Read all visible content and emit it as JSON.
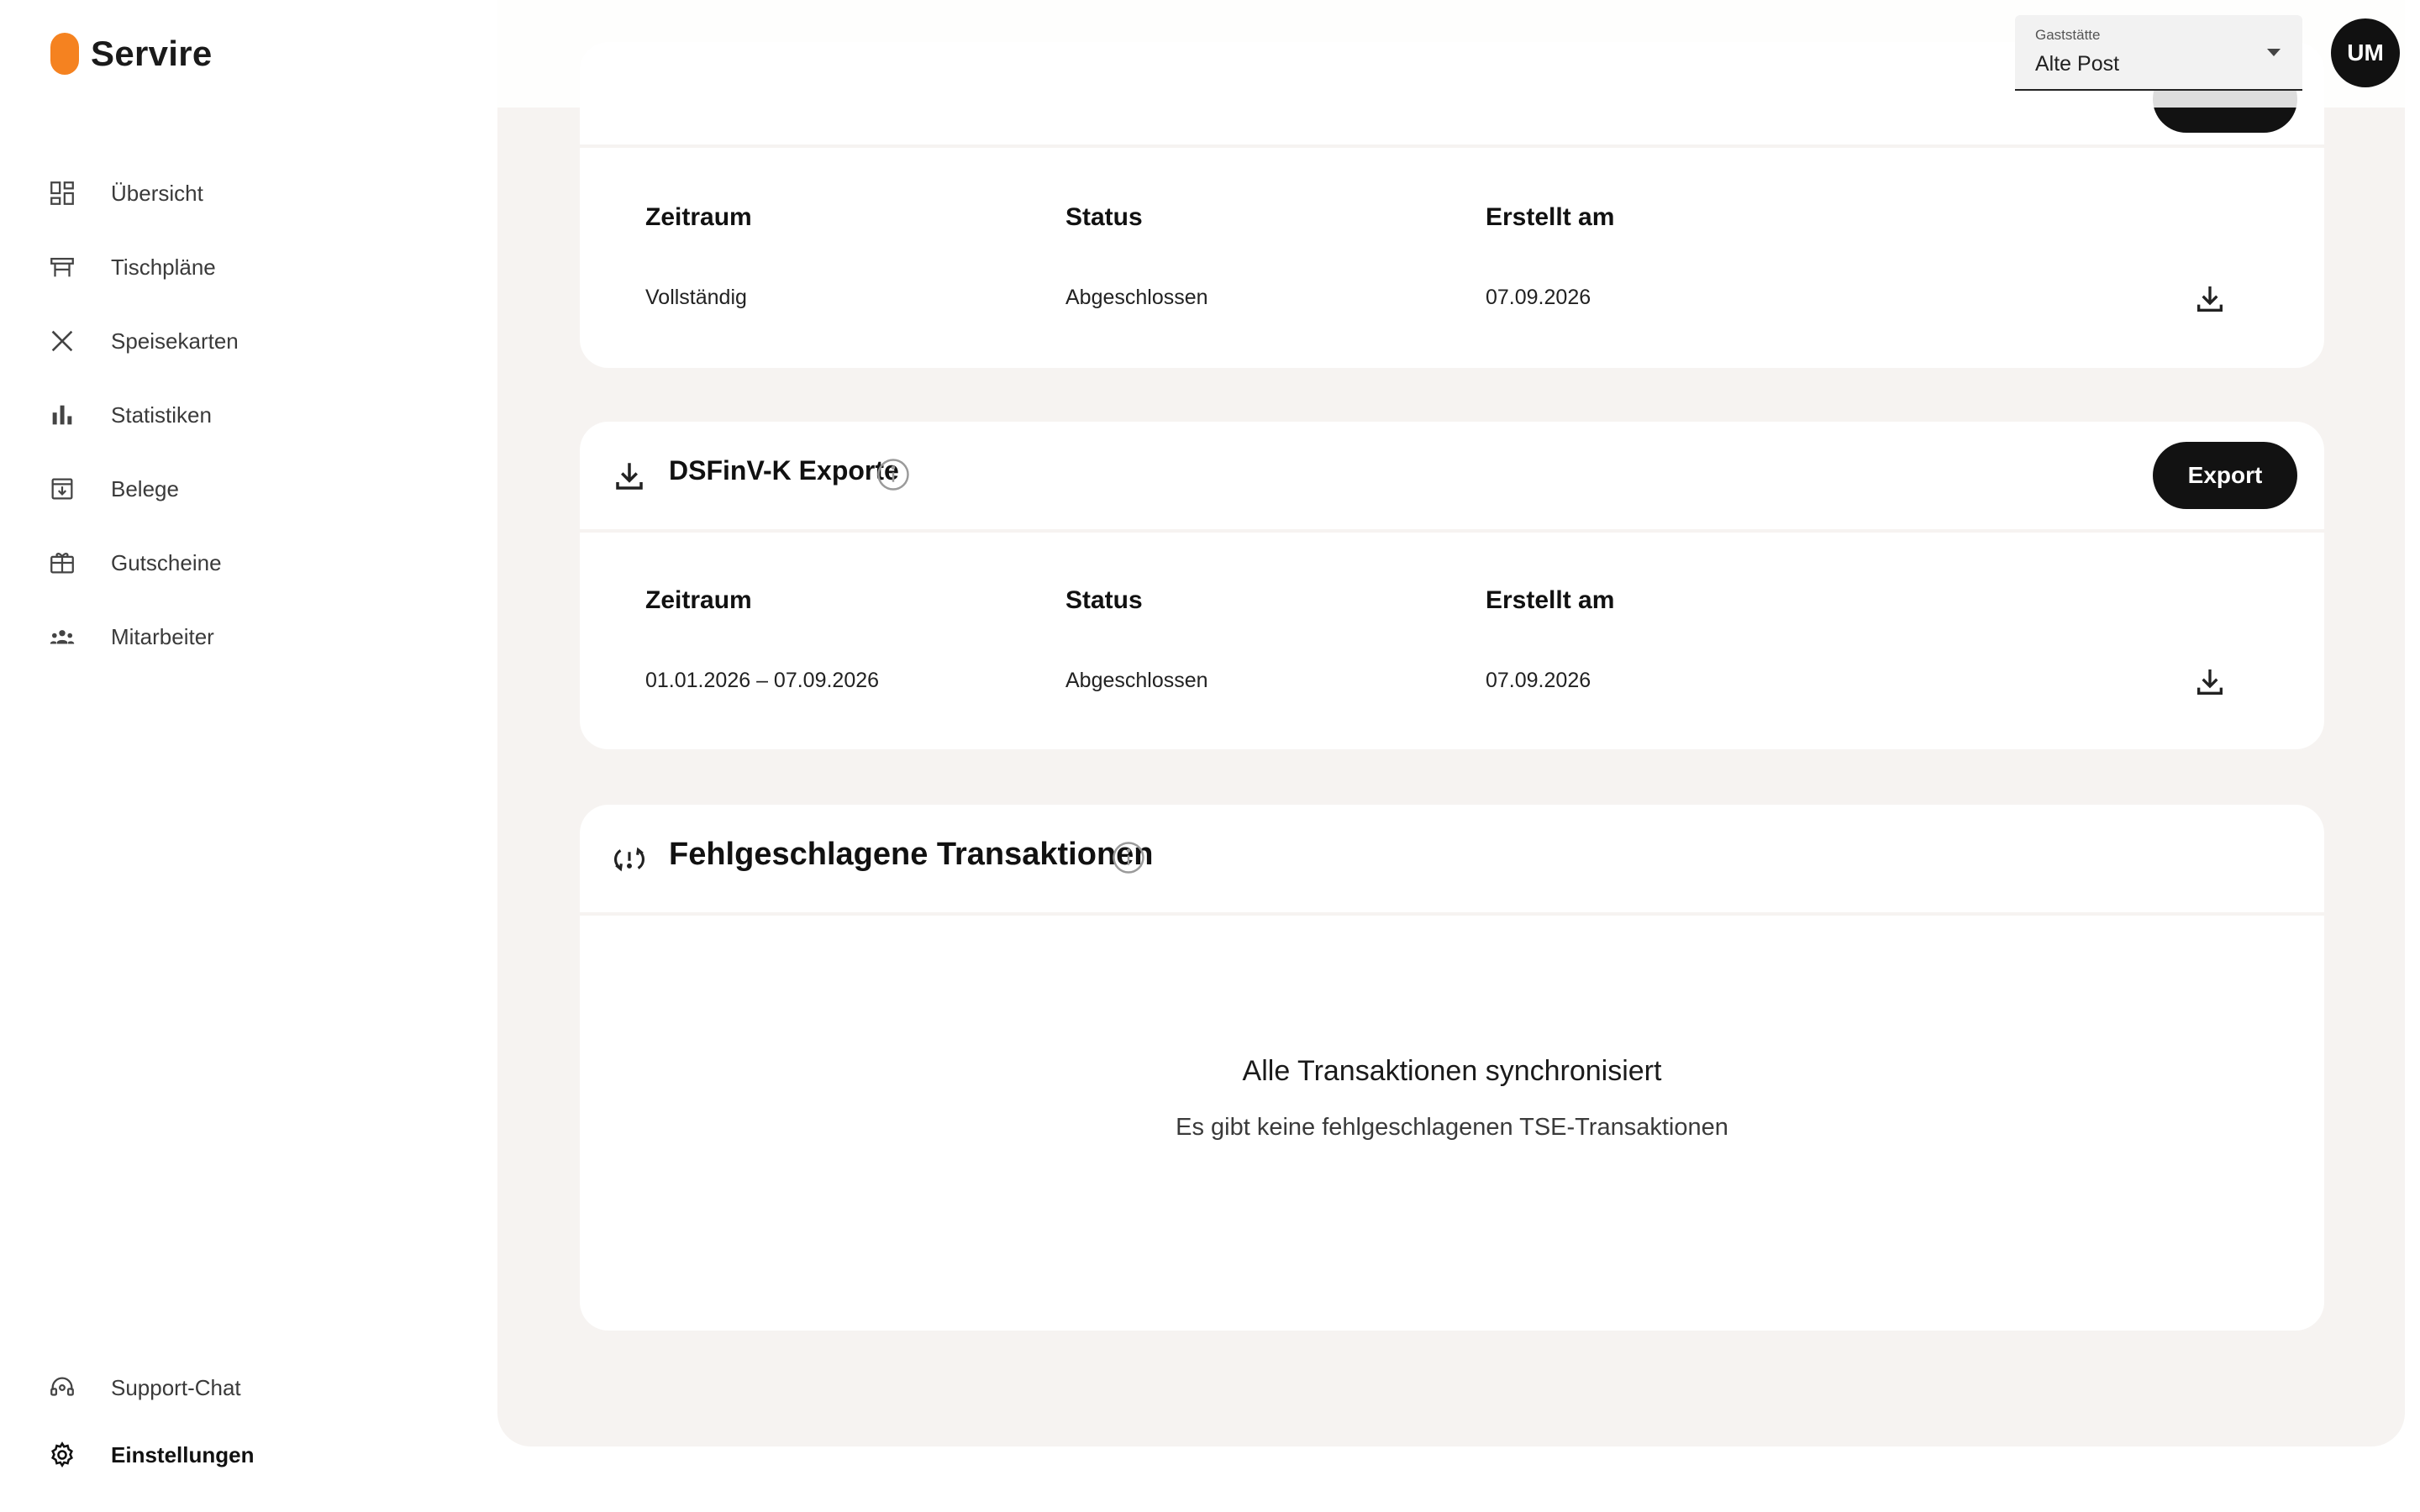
{
  "app": {
    "name": "Servire"
  },
  "sidebar": {
    "items": [
      {
        "label": "Übersicht",
        "icon": "dashboard-icon"
      },
      {
        "label": "Tischpläne",
        "icon": "table-icon"
      },
      {
        "label": "Speisekarten",
        "icon": "cutlery-icon"
      },
      {
        "label": "Statistiken",
        "icon": "bar-chart-icon"
      },
      {
        "label": "Belege",
        "icon": "receipt-icon"
      },
      {
        "label": "Gutscheine",
        "icon": "gift-card-icon"
      },
      {
        "label": "Mitarbeiter",
        "icon": "people-icon"
      }
    ],
    "bottom": [
      {
        "label": "Support-Chat",
        "icon": "headset-icon"
      },
      {
        "label": "Einstellungen",
        "icon": "gear-icon",
        "active": true
      }
    ]
  },
  "topbar": {
    "restaurant_select": {
      "caption": "Gaststätte",
      "value": "Alte Post"
    },
    "avatar_initials": "UM"
  },
  "sections": {
    "first_table": {
      "columns": [
        "Zeitraum",
        "Status",
        "Erstellt am"
      ],
      "rows": [
        {
          "zeitraum": "Vollständig",
          "status": "Abgeschlossen",
          "erstellt_am": "07.09.2026"
        }
      ]
    },
    "dsfinvk": {
      "title": "DSFinV-K Exporte",
      "export_label": "Export",
      "columns": [
        "Zeitraum",
        "Status",
        "Erstellt am"
      ],
      "rows": [
        {
          "zeitraum": "01.01.2026 – 07.09.2026",
          "status": "Abgeschlossen",
          "erstellt_am": "07.09.2026"
        }
      ]
    },
    "failed": {
      "title": "Fehlgeschlagene Transaktionen",
      "empty_title": "Alle Transaktionen synchronisiert",
      "empty_subtitle": "Es gibt keine fehlgeschlagenen TSE-Transaktionen"
    }
  },
  "colors": {
    "brand": "#f58220",
    "button": "#121212",
    "panel": "#f6f3f1"
  }
}
